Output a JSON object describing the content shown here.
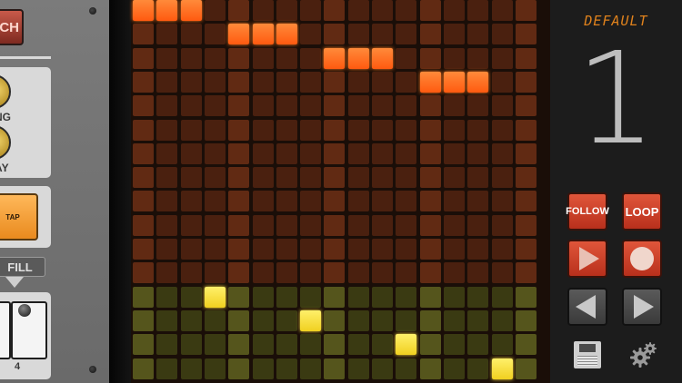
{
  "left_panel": {
    "ch_button_label": "CH",
    "knob_label_1": "NG",
    "knob_label_2": "AY",
    "tap_label": "TAP",
    "fill_label": "FILL",
    "pad_number": "4"
  },
  "grid": {
    "columns": 17,
    "top_rows": 12,
    "bottom_rows": 4,
    "top_active": [
      [
        0,
        0
      ],
      [
        1,
        0
      ],
      [
        2,
        0
      ],
      [
        4,
        1
      ],
      [
        5,
        1
      ],
      [
        6,
        1
      ],
      [
        8,
        2
      ],
      [
        9,
        2
      ],
      [
        10,
        2
      ],
      [
        12,
        3
      ],
      [
        13,
        3
      ],
      [
        14,
        3
      ]
    ],
    "bottom_active": [
      [
        3,
        0
      ],
      [
        7,
        1
      ],
      [
        11,
        2
      ],
      [
        15,
        3
      ]
    ],
    "highlight_columns": [
      0,
      4,
      8,
      12,
      16
    ],
    "colors": {
      "top_off": "#4a200f",
      "top_on": "#ff6a20",
      "bottom_off": "#3a3a12",
      "bottom_on": "#ffe040"
    }
  },
  "right_panel": {
    "preset_name": "DEFAULT",
    "pattern_number": "1",
    "follow_label": "FOLLOW",
    "loop_label": "LOOP",
    "play_icon": "play-icon",
    "record_icon": "record-icon",
    "prev_icon": "arrow-left-icon",
    "next_icon": "arrow-right-icon",
    "save_icon": "floppy-disk-icon",
    "settings_icon": "gear-icon"
  }
}
